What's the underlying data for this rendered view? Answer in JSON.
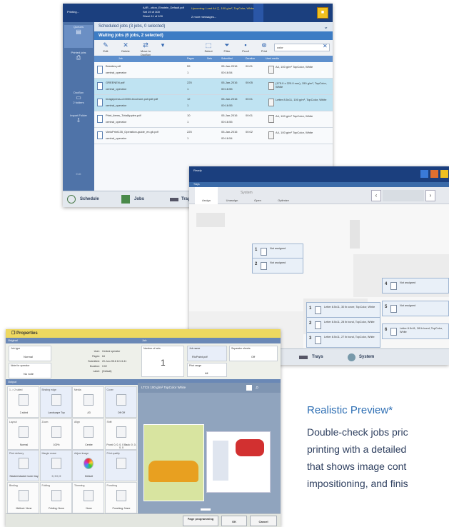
{
  "jobs_panel": {
    "status": {
      "title": "Printing...",
      "doc_line1": "A4R...otion_Einstein_Default.pdf",
      "doc_line2": "Set 19 of 300",
      "doc_line3": "Sheet 11 of 100",
      "warning": "Upcoming: Load A4 ◻, 100 g/m², TopColor, White",
      "more": "2 more messages..."
    },
    "sidebar": [
      {
        "label": "Queues",
        "sub": "Scheduled jobs (3 jobs, 0 selected)"
      },
      {
        "label": "Printed jobs"
      },
      {
        "label": "DocBox",
        "sub": "2 folders"
      },
      {
        "label": "Import Folder"
      },
      {
        "label": "Edit"
      }
    ],
    "scheduled_title": "Scheduled jobs (3 jobs, 0 selected)",
    "waiting_title": "Waiting jobs (6 jobs, 2 selected)",
    "toolbar": [
      "Edit",
      "Delete",
      "Move to DocBox",
      "Select",
      "Filter",
      "Proof",
      "Print"
    ],
    "search_value": "color",
    "columns": [
      "Job",
      "Pages",
      "Sets",
      "Submitted",
      "Duration",
      "Used media"
    ],
    "rows": [
      {
        "name": "Besides.pdf",
        "user": "central_operator",
        "pages": "59",
        "sets": "1",
        "date": "05-Jan-2016",
        "time": "00:16:54",
        "dur": "00:01",
        "media": "A4, 100 g/m² TopColor, White"
      },
      {
        "name": "GREENEN.pdf",
        "user": "central_operator",
        "pages": "225",
        "sets": "1",
        "date": "05-Jan-2016",
        "time": "00:16:55",
        "dur": "00:05",
        "media": "(175.0 x 220.0 mm), 150 g/m², TopColor, White"
      },
      {
        "name": "Imagepress-c10000-brochure.poll.pdf.pdf",
        "user": "central_operator",
        "pages": "12",
        "sets": "1",
        "date": "05-Jan-2016",
        "time": "00:16:55",
        "dur": "00:01",
        "media": "Letter 8.5x11, 100 g/m², TopColor, White"
      },
      {
        "name": "Print_items_TotalApples.pdf",
        "user": "central_operator",
        "pages": "10",
        "sets": "1",
        "date": "05-Jan-2016",
        "time": "00:16:55",
        "dur": "00:01",
        "media": "A4, 100 g/m² TopColor, White"
      },
      {
        "name": "VarioPrint135_Operation-guide_en.gb.pdf",
        "user": "central_operator",
        "pages": "225",
        "sets": "1",
        "date": "05-Jan-2016",
        "time": "00:16:54",
        "dur": "00:02",
        "media": "A4, 100 g/m² TopColor, White"
      }
    ],
    "bottom": {
      "schedule": "Schedule",
      "jobs": "Jobs",
      "trays": "Trays"
    }
  },
  "trays_panel": {
    "status": "Ready",
    "sub": "Trays",
    "tabs": [
      "Assign",
      "Unassign",
      "Open",
      "Optimize"
    ],
    "system_label": "System",
    "trays": [
      {
        "n": "1",
        "label": "Not assigned"
      },
      {
        "n": "2",
        "label": "Not assigned"
      },
      {
        "n": "1",
        "label": "Letter 8.5x11, 30 lb cover, TopColor, White"
      },
      {
        "n": "2",
        "label": "Letter 8.5x11, 28 lb bond, TopColor, White"
      },
      {
        "n": "3",
        "label": "Letter 8.5x11, 27 lb bond, TopColor, White"
      },
      {
        "n": "4",
        "label": "Not assigned"
      },
      {
        "n": "5",
        "label": "Not assigned"
      },
      {
        "n": "6",
        "label": "Letter 8.5x11, 28 lb bond, TopColor, White"
      }
    ],
    "bottom": {
      "trays": "Trays",
      "system": "System"
    }
  },
  "properties_panel": {
    "title": "Properties",
    "original": "Original",
    "job": "Job",
    "output": "Output",
    "job_type_label": "Job type",
    "job_type": "Normal",
    "note_label": "Note for operator",
    "note": "No note",
    "info": [
      {
        "k": "User:",
        "v": "Central operator"
      },
      {
        "k": "Pages:",
        "v": "64"
      },
      {
        "k": "Submitted:",
        "v": "20-Jun-2016 12:41:41"
      },
      {
        "k": "Duration:",
        "v": "0:02"
      },
      {
        "k": "Label:",
        "v": "(Default)"
      }
    ],
    "sets_label": "Number of sets",
    "sets": "1",
    "jobname_label": "Job name",
    "jobname": "RicPaint.pdf",
    "separator_label": "Separator sheets",
    "separator": "Off",
    "print_range_label": "Print range",
    "print_range": "All",
    "cells": [
      {
        "lb": "1 -> 2 sided",
        "vl": "2-sided"
      },
      {
        "lb": "Binding edge",
        "vl": "Landscape Top"
      },
      {
        "lb": "Media",
        "vl": "A3"
      },
      {
        "lb": "Cover",
        "vl": "Off Off"
      },
      {
        "lb": "Layout",
        "vl": "Normal"
      },
      {
        "lb": "Zoom",
        "vl": "100%"
      },
      {
        "lb": "Align",
        "vl": "Centre"
      },
      {
        "lb": "Shift",
        "vl": "Front: 0, 0, 0, 0 Back: 0, 0, 0, 0"
      },
      {
        "lb": "Print delivery",
        "vl": "Stacker/stacker lower tray"
      },
      {
        "lb": "Margin erase",
        "vl": "0, 0 0, 0"
      },
      {
        "lb": "Adjust image",
        "vl": "Default"
      },
      {
        "lb": "Print quality",
        "vl": ""
      },
      {
        "lb": "Binding",
        "vl": "Method: None"
      },
      {
        "lb": "Folding",
        "vl": "Folding: None"
      },
      {
        "lb": "Trimming",
        "vl": "None"
      },
      {
        "lb": "Punching",
        "vl": "Punching: None"
      }
    ],
    "preview_media": "LTCS 100 g/m² TopColor White",
    "buttons": {
      "page_programming": "Page programming",
      "ok": "OK",
      "cancel": "Cancel"
    }
  },
  "marketing": {
    "heading": "Realistic Preview*",
    "lines": [
      "Double-check jobs pric",
      "printing with a detailed",
      "that shows image cont",
      "impositioning, and finis"
    ]
  }
}
